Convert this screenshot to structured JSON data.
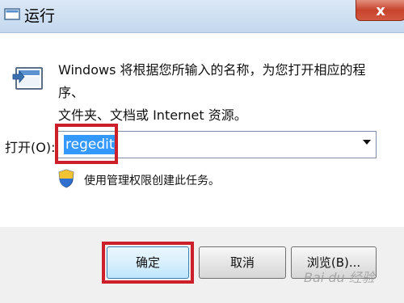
{
  "window": {
    "title": "运行",
    "close_glyph": "x"
  },
  "description": {
    "line1": "Windows 将根据您所输入的名称，为您打开相应的程序、",
    "line2": "文件夹、文档或 Internet 资源。"
  },
  "open_field": {
    "label": "打开(O):",
    "value": "regedit"
  },
  "admin_note": "使用管理权限创建此任务。",
  "buttons": {
    "ok": "确定",
    "cancel": "取消",
    "browse": "浏览(B)..."
  },
  "watermark": "Bai du 经验",
  "colors": {
    "highlight_border": "#cc1f2a",
    "selection": "#3399ff",
    "titlebar": "#c4d8ee"
  },
  "icons": [
    "run-icon",
    "shield-icon",
    "close-icon",
    "title-icon"
  ]
}
